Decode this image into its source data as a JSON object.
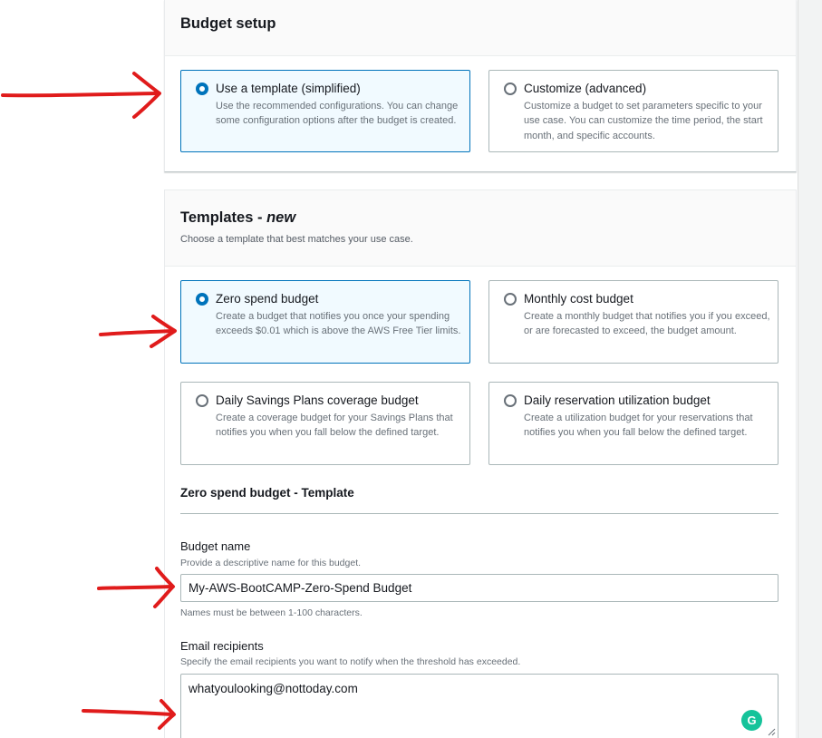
{
  "setup": {
    "title": "Budget setup",
    "options": [
      {
        "label": "Use a template (simplified)",
        "description": "Use the recommended configurations. You can change some configuration options after the budget is created.",
        "selected": true
      },
      {
        "label": "Customize (advanced)",
        "description": "Customize a budget to set parameters specific to your use case. You can customize the time period, the start month, and specific accounts.",
        "selected": false
      }
    ]
  },
  "templates": {
    "title": "Templates - ",
    "title_emphasis": "new",
    "subtitle": "Choose a template that best matches your use case.",
    "options": [
      {
        "label": "Zero spend budget",
        "description": "Create a budget that notifies you once your spending exceeds $0.01 which is above the AWS Free Tier limits.",
        "selected": true
      },
      {
        "label": "Monthly cost budget",
        "description": "Create a monthly budget that notifies you if you exceed, or are forecasted to exceed, the budget amount.",
        "selected": false
      },
      {
        "label": "Daily Savings Plans coverage budget",
        "description": "Create a coverage budget for your Savings Plans that notifies you when you fall below the defined target.",
        "selected": false
      },
      {
        "label": "Daily reservation utilization budget",
        "description": "Create a utilization budget for your reservations that notifies you when you fall below the defined target.",
        "selected": false
      }
    ]
  },
  "template_form": {
    "section_title": "Zero spend budget - Template",
    "budget_name": {
      "label": "Budget name",
      "description": "Provide a descriptive name for this budget.",
      "value": "My-AWS-BootCAMP-Zero-Spend Budget",
      "constraint": "Names must be between 1-100 characters."
    },
    "email_recipients": {
      "label": "Email recipients",
      "description": "Specify the email recipients you want to notify when the threshold has exceeded.",
      "value": "whatyoulooking@nottoday.com"
    }
  },
  "grammarly_badge": {
    "icon": "grammarly-icon",
    "letter": "G",
    "color": "#15c39a"
  },
  "colors": {
    "accent": "#0073bb",
    "selected_bg": "#f1faff",
    "annotation_arrow": "#e01b1b"
  }
}
